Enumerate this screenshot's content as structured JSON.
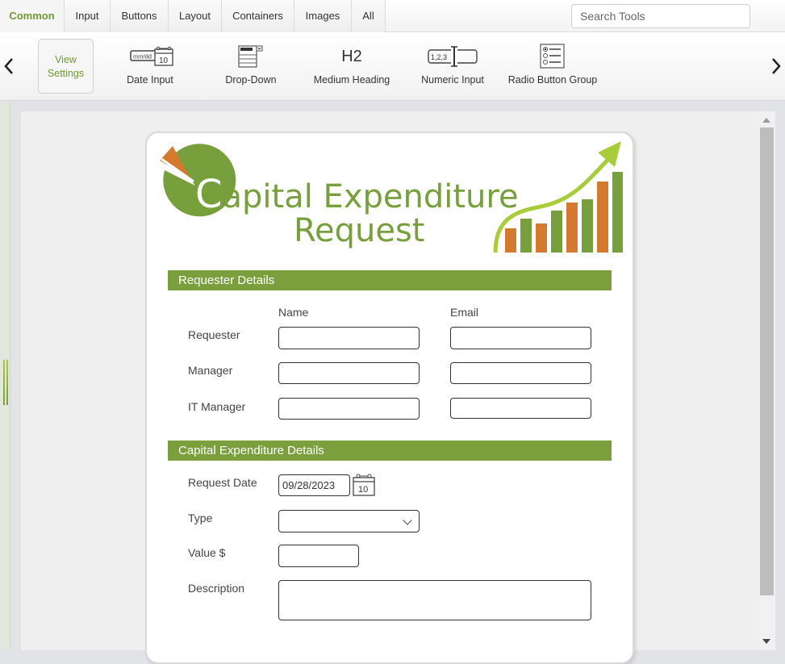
{
  "tabs": [
    {
      "label": "Common",
      "active": true
    },
    {
      "label": "Input",
      "active": false
    },
    {
      "label": "Buttons",
      "active": false
    },
    {
      "label": "Layout",
      "active": false
    },
    {
      "label": "Containers",
      "active": false
    },
    {
      "label": "Images",
      "active": false
    },
    {
      "label": "All",
      "active": false
    }
  ],
  "search": {
    "placeholder": "Search Tools",
    "value": ""
  },
  "toolbar": {
    "view_settings_line1": "View",
    "view_settings_line2": "Settings",
    "tools": [
      {
        "label": "Date Input",
        "icon": "date-input-icon",
        "icon_text_left": "mm/dd",
        "icon_text_right": "10"
      },
      {
        "label": "Drop-Down",
        "icon": "drop-down-icon"
      },
      {
        "label": "Medium Heading",
        "icon": "heading-h2-icon",
        "icon_text": "H2"
      },
      {
        "label": "Numeric Input",
        "icon": "numeric-input-icon",
        "icon_text": "1,2,3"
      },
      {
        "label": "Radio Button Group",
        "icon": "radio-group-icon"
      }
    ],
    "prev_icon": "chevron-left-icon",
    "next_icon": "chevron-right-icon"
  },
  "form": {
    "title_first_letter": "C",
    "title_line1_rest": "apital Expenditure",
    "title_line2": "Request",
    "colors": {
      "green": "#7a9f3c",
      "orange": "#d47a30",
      "lime": "#a8cc3a"
    },
    "requester_section": {
      "title": "Requester Details",
      "col_name": "Name",
      "col_email": "Email",
      "rows": [
        {
          "label": "Requester",
          "name": "",
          "email": ""
        },
        {
          "label": "Manager",
          "name": "",
          "email": ""
        },
        {
          "label": "IT Manager",
          "name": "",
          "email": ""
        }
      ]
    },
    "capex_section": {
      "title": "Capital Expenditure Details",
      "request_date_label": "Request Date",
      "request_date_value": "09/28/2023",
      "calendar_day": "10",
      "type_label": "Type",
      "type_value": "",
      "value_label": "Value $",
      "value_value": "",
      "description_label": "Description",
      "description_value": ""
    }
  }
}
